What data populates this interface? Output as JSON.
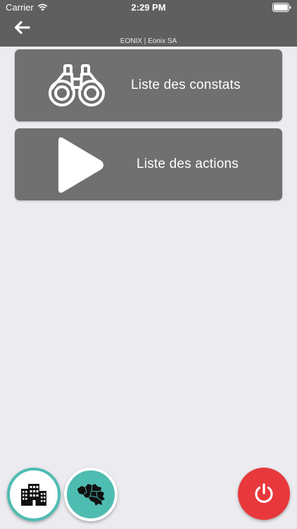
{
  "status_bar": {
    "carrier": "Carrier",
    "time": "2:29 PM",
    "wifi_icon": "wifi-icon",
    "battery_icon": "battery-icon"
  },
  "nav": {
    "back_icon": "arrow-left-icon",
    "subtitle": "EONIX | Eonix SA"
  },
  "menu": [
    {
      "label": "Liste des constats",
      "icon": "binoculars-icon"
    },
    {
      "label": "Liste des actions",
      "icon": "play-icon"
    }
  ],
  "fabs": {
    "buildings": {
      "icon": "buildings-icon"
    },
    "map": {
      "icon": "belgium-map-icon"
    },
    "power": {
      "icon": "power-icon"
    }
  },
  "colors": {
    "header": "#5f5f5f",
    "background": "#ebebf0",
    "card": "#707070",
    "teal": "#4fbcb2",
    "power_red": "#e8383b"
  }
}
